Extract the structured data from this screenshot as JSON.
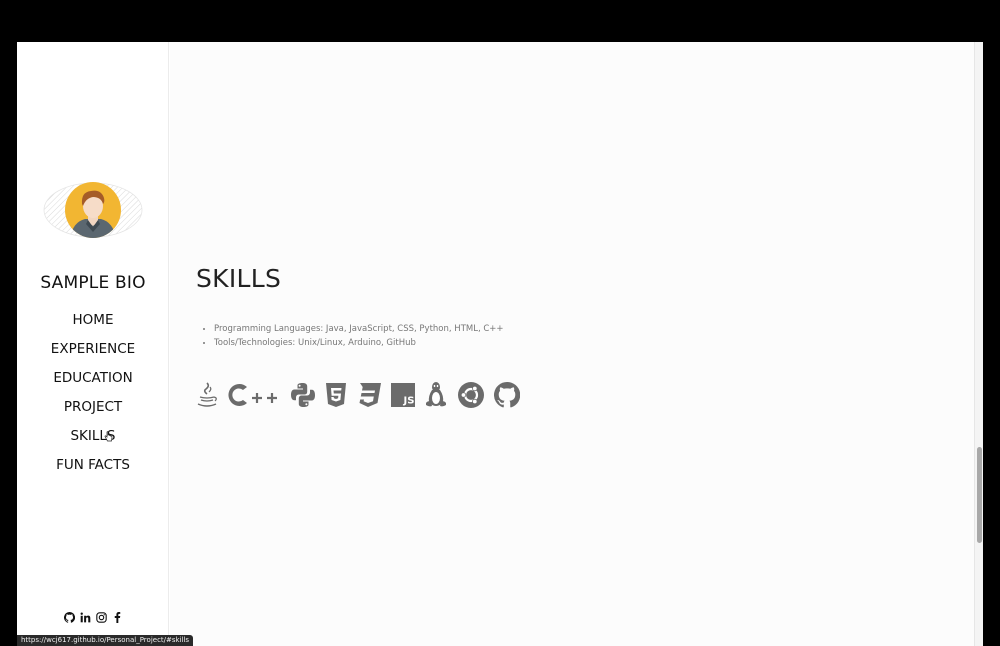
{
  "site": {
    "brand": "SAMPLE BIO"
  },
  "nav": {
    "items": [
      {
        "label": "HOME"
      },
      {
        "label": "EXPERIENCE"
      },
      {
        "label": "EDUCATION"
      },
      {
        "label": "PROJECT"
      },
      {
        "label": "SKILLS"
      },
      {
        "label": "FUN FACTS"
      }
    ]
  },
  "socials": [
    "github-icon",
    "linkedin-icon",
    "instagram-icon",
    "facebook-icon"
  ],
  "skills": {
    "title": "SKILLS",
    "items": [
      "Programming Languages: Java, JavaScript, CSS, Python, HTML, C++",
      "Tools/Technologies: Unix/Linux, Arduino, GitHub"
    ],
    "icons": [
      "java-icon",
      "cplusplus-icon",
      "python-icon",
      "html5-icon",
      "css3-icon",
      "javascript-icon",
      "linux-icon",
      "ubuntu-icon",
      "github-icon"
    ]
  },
  "status_bar": {
    "url": "https://wcj617.github.io/Personal_Project/#skills"
  },
  "colors": {
    "icon_gray": "#6b6b6b",
    "avatar_bg": "#f2b632",
    "text": "#111111"
  }
}
